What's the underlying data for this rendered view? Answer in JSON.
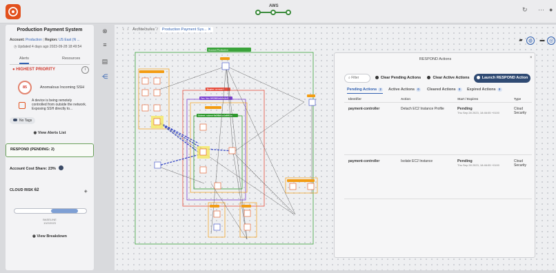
{
  "topbar": {
    "stepper_label": "AWS",
    "icons": [
      "refresh-icon",
      "more-icon",
      "user-icon"
    ]
  },
  "left_panel": {
    "title": "Production Payment System",
    "account_label": "Account:",
    "account_value": "Production",
    "region_label": "Region:",
    "region_value": "US East (N ...",
    "updated": "Updated 4 days ago 2023-09-28 18:49:54",
    "tabs": [
      "Alerts",
      "Resources"
    ],
    "priority_heading": "HIGHEST PRIORITY",
    "alert_score": "85",
    "alert_name": "Anomalous Incoming SSH",
    "alert_description": "A device is being remotely controlled from outside the network. Exposing SSH directly to...",
    "tags_label": "No Tags",
    "view_alerts": "View Alerts List",
    "respond_label": "RESPOND (PENDING: 2)",
    "cost_share_label": "Account Cost Share: 23%",
    "cloud_risk_label": "CLOUD RISK",
    "cloud_risk_value": "62",
    "cloud_risk_fill_from": 0.51,
    "cloud_risk_fill_to": 0.88,
    "cloud_risk_date_line1": "BASELINE",
    "cloud_risk_date_line2": "10/2/2023",
    "view_breakdown": "View Breakdown"
  },
  "rail": [
    "close-icon",
    "menu-icon",
    "list-icon",
    "graph-icon"
  ],
  "canvas": {
    "breadcrumb_root": "Architectures",
    "breadcrumb_separator": "/",
    "breadcrumb_current": "Production Payment Sys...",
    "tool_icons": [
      "tag-icon",
      "globe-icon",
      "layers-icon",
      "settings-icon"
    ]
  },
  "respond_panel": {
    "title": "RESPOND Actions",
    "filter_placeholder": "Filter",
    "buttons": {
      "clear_pending": "Clear Pending Actions",
      "clear_active": "Clear Active Actions",
      "launch": "Launch RESPOND Action"
    },
    "tabs": [
      {
        "label": "Pending Actions",
        "count": "2"
      },
      {
        "label": "Active Actions",
        "count": "0"
      },
      {
        "label": "Cleared Actions",
        "count": "0"
      },
      {
        "label": "Expired Actions",
        "count": "0"
      }
    ],
    "columns": [
      "Identifier",
      "Action",
      "Start / Expires",
      "Type"
    ],
    "rows": [
      {
        "identifier": "payment-controller",
        "action": "Detach EC2 Instance Profile",
        "status": "Pending",
        "time": "Thu Sep 28 2023, 18:46:05 +0100",
        "type": "Cloud Security"
      },
      {
        "identifier": "payment-controller",
        "action": "Isolate EC2 Instance",
        "status": "Pending",
        "time": "Thu Sep 28 2023, 18:46:05 +0100",
        "type": "Cloud Security"
      }
    ]
  },
  "diagram": {
    "labels": {
      "account": "Account Production",
      "region": "Region: us-east-1",
      "vpc": "Vpc: Vpc-0f4286f0e6d6a3e43",
      "subnet": "Subnet: subnet-0a5f8b8ce1a99f1ba"
    },
    "colors": {
      "account": "#3aa33a",
      "region": "#e74c3c",
      "vpc": "#7b3fd1",
      "subnet": "#2e9a2e",
      "orange": "#f39c12",
      "compromised": "#f5e96a",
      "path": "#3345c4"
    }
  }
}
